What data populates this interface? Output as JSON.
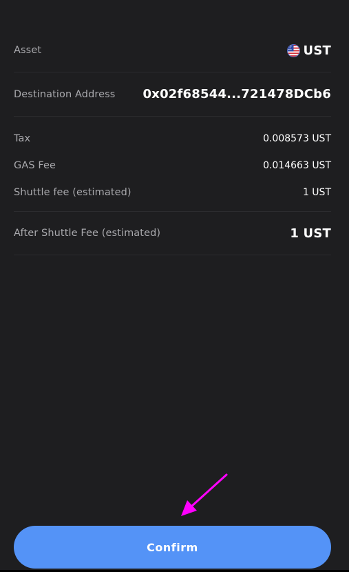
{
  "summary": {
    "asset": {
      "label": "Asset",
      "value": "UST",
      "icon": "us-flag-coin-icon"
    },
    "destination": {
      "label": "Destination Address",
      "value": "0x02f68544...721478DCb6"
    },
    "fees": [
      {
        "label": "Tax",
        "value": "0.008573 UST"
      },
      {
        "label": "GAS Fee",
        "value": "0.014663 UST"
      },
      {
        "label": "Shuttle fee (estimated)",
        "value": "1 UST"
      }
    ],
    "after_fee": {
      "label": "After Shuttle Fee (estimated)",
      "value": "1 UST"
    }
  },
  "actions": {
    "confirm_label": "Confirm"
  },
  "colors": {
    "background": "#1e1e20",
    "accent": "#5493f7",
    "annotation": "#ff00ff"
  }
}
